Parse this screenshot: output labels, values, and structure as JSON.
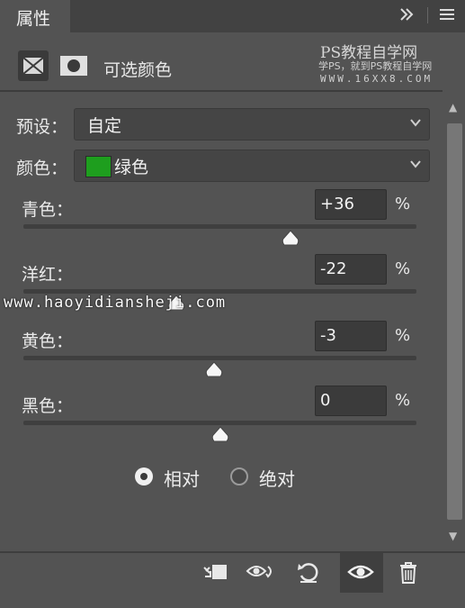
{
  "panel": {
    "tab_title": "属性",
    "title": "可选颜色",
    "collapse_icon": "double-chevron-right-icon",
    "menu_icon": "hamburger-menu-icon"
  },
  "watermark": {
    "line1": "PS教程自学网",
    "line2": "学PS，就到PS教程自学网",
    "line3": "WWW.16XX8.COM",
    "overlay_url": "www.haoyidiansheji.com"
  },
  "preset": {
    "label": "预设：",
    "value": "自定"
  },
  "color": {
    "label": "颜色：",
    "value": "绿色",
    "swatch": "#1e9e1e"
  },
  "sliders": [
    {
      "label": "青色：",
      "value": "+36",
      "unit": "%",
      "level": 36
    },
    {
      "label": "洋红：",
      "value": "-22",
      "unit": "%",
      "level": -22
    },
    {
      "label": "黄色：",
      "value": "-3",
      "unit": "%",
      "level": -3
    },
    {
      "label": "黑色：",
      "value": "0",
      "unit": "%",
      "level": 0
    }
  ],
  "method": {
    "options": [
      {
        "label": "相对",
        "selected": true
      },
      {
        "label": "绝对",
        "selected": false
      }
    ]
  },
  "footer_icons": [
    "clip-to-layer-icon",
    "view-previous-icon",
    "reset-icon",
    "visibility-eye-icon",
    "trash-icon"
  ]
}
